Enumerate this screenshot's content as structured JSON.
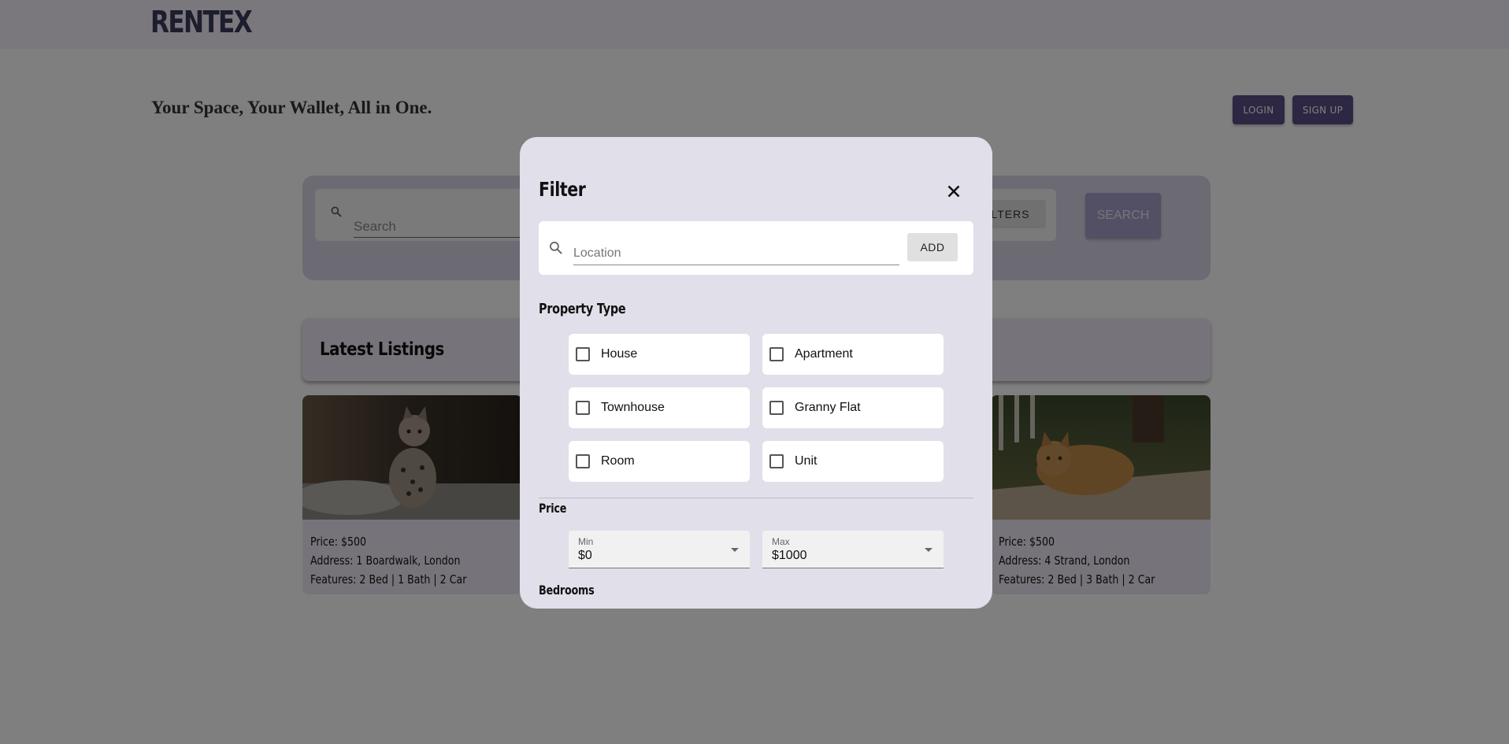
{
  "header": {
    "brand": "RENTEX",
    "tagline": "Your Space, Your Wallet, All in One.",
    "login_label": "LOGIN",
    "signup_label": "SIGN UP"
  },
  "search": {
    "placeholder": "Search",
    "filters_label": "FILTERS",
    "filters_visible": "LTERS",
    "search_button": "SEARCH"
  },
  "listings": {
    "title": "Latest Listings",
    "cards": [
      {
        "price": "Price: $500",
        "address": "Address: 1 Boardwalk, London",
        "features": "Features: 2 Bed | 1 Bath | 2 Car",
        "image": "tabby-wildcat-photo"
      },
      {
        "price": "Price: $500",
        "address": "Address: 4 Strand, London",
        "features": "Features: 2 Bed | 3 Bath | 2 Car",
        "image": "orange-cat-photo"
      }
    ]
  },
  "filter_modal": {
    "title": "Filter",
    "close_icon": "close-icon",
    "location": {
      "placeholder": "Location",
      "value": "",
      "add_label": "ADD",
      "icon": "search-icon"
    },
    "property_type": {
      "label": "Property Type",
      "options": [
        {
          "label": "House",
          "checked": false
        },
        {
          "label": "Apartment",
          "checked": false
        },
        {
          "label": "Townhouse",
          "checked": false
        },
        {
          "label": "Granny Flat",
          "checked": false
        },
        {
          "label": "Room",
          "checked": false
        },
        {
          "label": "Unit",
          "checked": false
        }
      ]
    },
    "price": {
      "label": "Price",
      "min": {
        "caption": "Min",
        "value": "$0"
      },
      "max": {
        "caption": "Max",
        "value": "$1000"
      }
    },
    "bedrooms_label": "Bedrooms"
  },
  "colors": {
    "brand": "#3d3a5c",
    "accent_button": "#5c4f86",
    "modal_bg": "#e1dfe9",
    "overlay": "rgba(0,0,0,0.5)"
  }
}
